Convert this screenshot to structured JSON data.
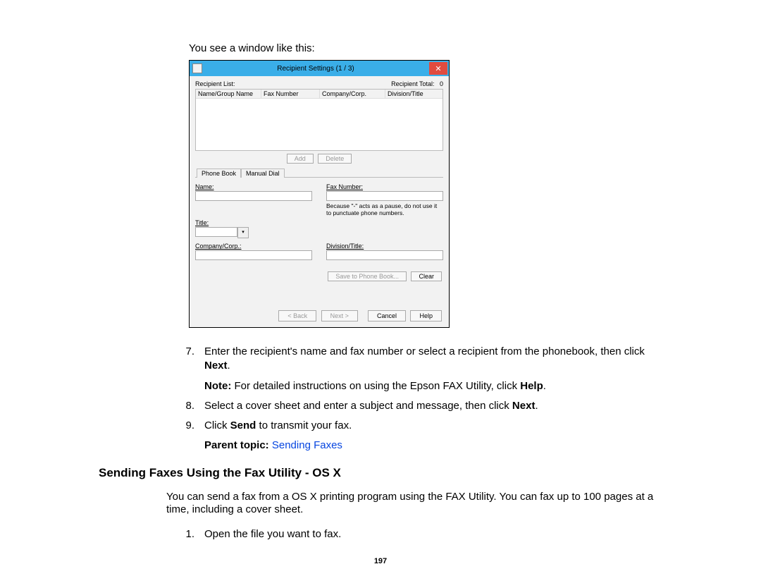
{
  "intro": "You see a window like this:",
  "dialog": {
    "title": "Recipient Settings (1 / 3)",
    "close": "✕",
    "recipient_list_label": "Recipient List:",
    "recipient_total_label": "Recipient Total:",
    "recipient_total_value": "0",
    "columns": {
      "c1": "Name/Group Name",
      "c2": "Fax Number",
      "c3": "Company/Corp.",
      "c4": "Division/Title"
    },
    "buttons": {
      "add": "Add",
      "delete": "Delete",
      "save": "Save to Phone Book...",
      "clear": "Clear",
      "back": "< Back",
      "next": "Next >",
      "cancel": "Cancel",
      "help": "Help"
    },
    "tabs": {
      "t1": "Phone Book",
      "t2": "Manual Dial"
    },
    "fields": {
      "name": "Name:",
      "title": "Title:",
      "company": "Company/Corp.:",
      "fax": "Fax Number:",
      "division": "Division/Title:",
      "fax_hint": "Because \"-\" acts as a pause, do not use it to punctuate phone numbers."
    }
  },
  "steps": {
    "s7_num": "7.",
    "s7": "Enter the recipient's name and fax number or select a recipient from the phonebook, then click ",
    "s7_bold": "Next",
    "s7_tail": ".",
    "note_label": "Note:",
    "note_text": " For detailed instructions on using the Epson FAX Utility, click ",
    "note_bold": "Help",
    "note_tail": ".",
    "s8_num": "8.",
    "s8_a": "Select a cover sheet and enter a subject and message, then click ",
    "s8_bold": "Next",
    "s8_tail": ".",
    "s9_num": "9.",
    "s9_a": "Click ",
    "s9_bold": "Send",
    "s9_b": " to transmit your fax."
  },
  "parent": {
    "label": "Parent topic:",
    "link": "Sending Faxes"
  },
  "section2": {
    "heading": "Sending Faxes Using the Fax Utility - OS X",
    "para": "You can send a fax from a OS X printing program using the FAX Utility. You can fax up to 100 pages at a time, including a cover sheet.",
    "s1_num": "1.",
    "s1": "Open the file you want to fax."
  },
  "pagenum": "197"
}
